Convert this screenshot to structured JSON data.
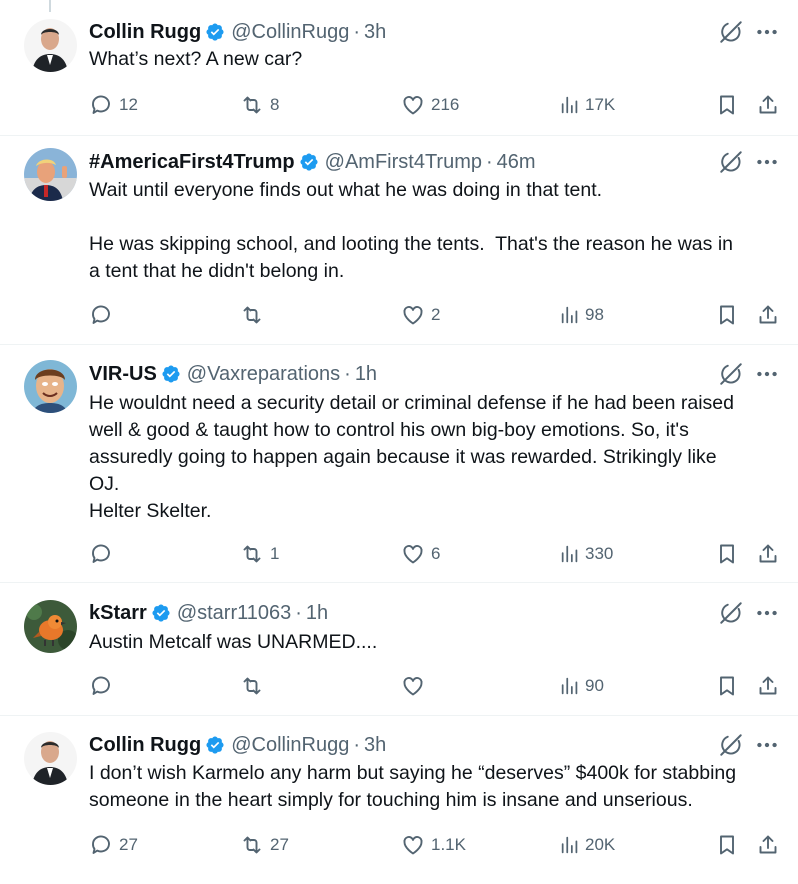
{
  "colors": {
    "text": "#0f1419",
    "secondary": "#536471",
    "verified": "#1d9bf0",
    "divider": "#eff3f4"
  },
  "tweets": [
    {
      "name": "Collin Rugg",
      "handle": "@CollinRugg",
      "time": "3h",
      "text": "What’s next? A new car?",
      "replies": "12",
      "retweets": "8",
      "likes": "216",
      "views": "17K",
      "avatar": "collin-rugg-avatar"
    },
    {
      "name": "#AmericaFirst4Trump",
      "handle": "@AmFirst4Trump",
      "time": "46m",
      "text": "Wait until everyone finds out what he was doing in that tent.\n\nHe was skipping school, and looting the tents.  That's the reason he was in\na tent that he didn't belong in.",
      "replies": "",
      "retweets": "",
      "likes": "2",
      "views": "98",
      "avatar": "trump-avatar"
    },
    {
      "name": "VIR-US",
      "handle": "@Vaxreparations",
      "time": "1h",
      "text": "He wouldnt need a security detail or criminal defense if he had been raised\nwell & good & taught how to control his own big-boy emotions. So, it's\nassuredly going to happen again because it was rewarded. Strikingly like\nOJ.\nHelter Skelter.",
      "replies": "",
      "retweets": "1",
      "likes": "6",
      "views": "330",
      "avatar": "cartoon-man-avatar"
    },
    {
      "name": "kStarr",
      "handle": "@starr11063",
      "time": "1h",
      "text": "Austin Metcalf was UNARMED....",
      "replies": "",
      "retweets": "",
      "likes": "",
      "views": "90",
      "avatar": "bird-avatar"
    },
    {
      "name": "Collin Rugg",
      "handle": "@CollinRugg",
      "time": "3h",
      "text": "I don’t wish Karmelo any harm but saying he “deserves” $400k for stabbing\nsomeone in the heart simply for touching him is insane and unserious.",
      "replies": "27",
      "retweets": "27",
      "likes": "1.1K",
      "views": "20K",
      "avatar": "collin-rugg-avatar"
    }
  ]
}
